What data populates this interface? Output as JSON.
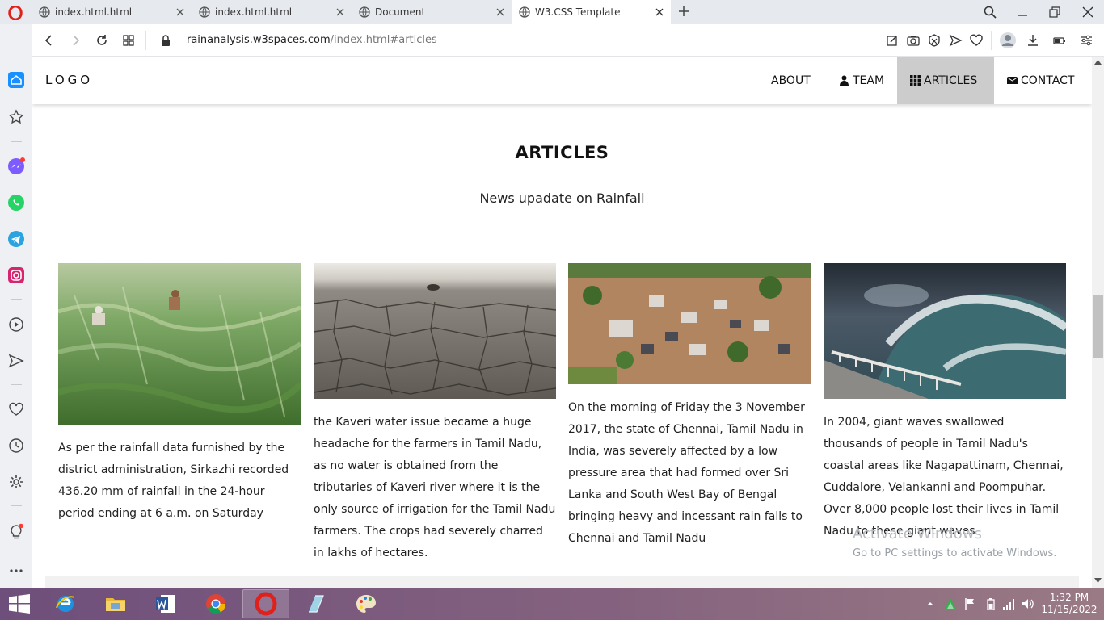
{
  "browser": {
    "tabs": [
      {
        "title": "index.html.html",
        "active": false
      },
      {
        "title": "index.html.html",
        "active": false
      },
      {
        "title": "Document",
        "active": false
      },
      {
        "title": "W3.CSS Template",
        "active": true
      }
    ],
    "url_host": "rainanalysis.w3spaces.com",
    "url_path": "/index.html#articles"
  },
  "sidebar_icons": [
    "home-icon",
    "star-icon",
    "messenger-icon",
    "whatsapp-icon",
    "telegram-icon",
    "instagram-icon",
    "player-icon",
    "send-icon",
    "heart-icon",
    "history-icon",
    "settings-icon",
    "lightbulb-icon",
    "more-icon"
  ],
  "site": {
    "logo": "LOGO",
    "nav": {
      "about": "ABOUT",
      "team": "TEAM",
      "articles": "ARTICLES",
      "contact": "CONTACT"
    }
  },
  "articles": {
    "title": "ARTICLES",
    "subtitle": "News upadate on Rainfall",
    "cards": [
      {
        "image": "flattened-paddy-field-photo",
        "text": "As per the rainfall data furnished by the district administration, Sirkazhi recorded 436.20 mm of rainfall in the 24-hour period ending at 6 a.m. on Saturday"
      },
      {
        "image": "cracked-dry-riverbed-photo",
        "text": "the Kaveri water issue became a huge headache for the farmers in Tamil Nadu, as no water is obtained from the tributaries of Kaveri river where it is the only source of irrigation for the Tamil Nadu farmers. The crops had severely charred in lakhs of hectares."
      },
      {
        "image": "flooded-town-aerial-photo",
        "text": "On the morning of Friday the 3 November 2017, the state of Chennai, Tamil Nadu in India, was severely affected by a low pressure area that had formed over Sri Lanka and South West Bay of Bengal bringing heavy and incessant rain falls to Chennai and Tamil Nadu"
      },
      {
        "image": "tsunami-wave-photo",
        "text": "In 2004, giant waves swallowed thousands of people in Tamil Nadu's coastal areas like Nagapattinam, Chennai, Cuddalore, Velankanni and Poompuhar. Over 8,000 people lost their lives in Tamil Nadu to these giant waves"
      }
    ]
  },
  "watermark": {
    "line1": "Activate Windows",
    "line2": "Go to PC settings to activate Windows."
  },
  "taskbar": {
    "apps": [
      "internet-explorer-icon",
      "file-explorer-icon",
      "word-icon",
      "chrome-icon",
      "opera-icon",
      "app-icon",
      "paint-icon"
    ],
    "time": "1:32 PM",
    "date": "11/15/2022"
  }
}
